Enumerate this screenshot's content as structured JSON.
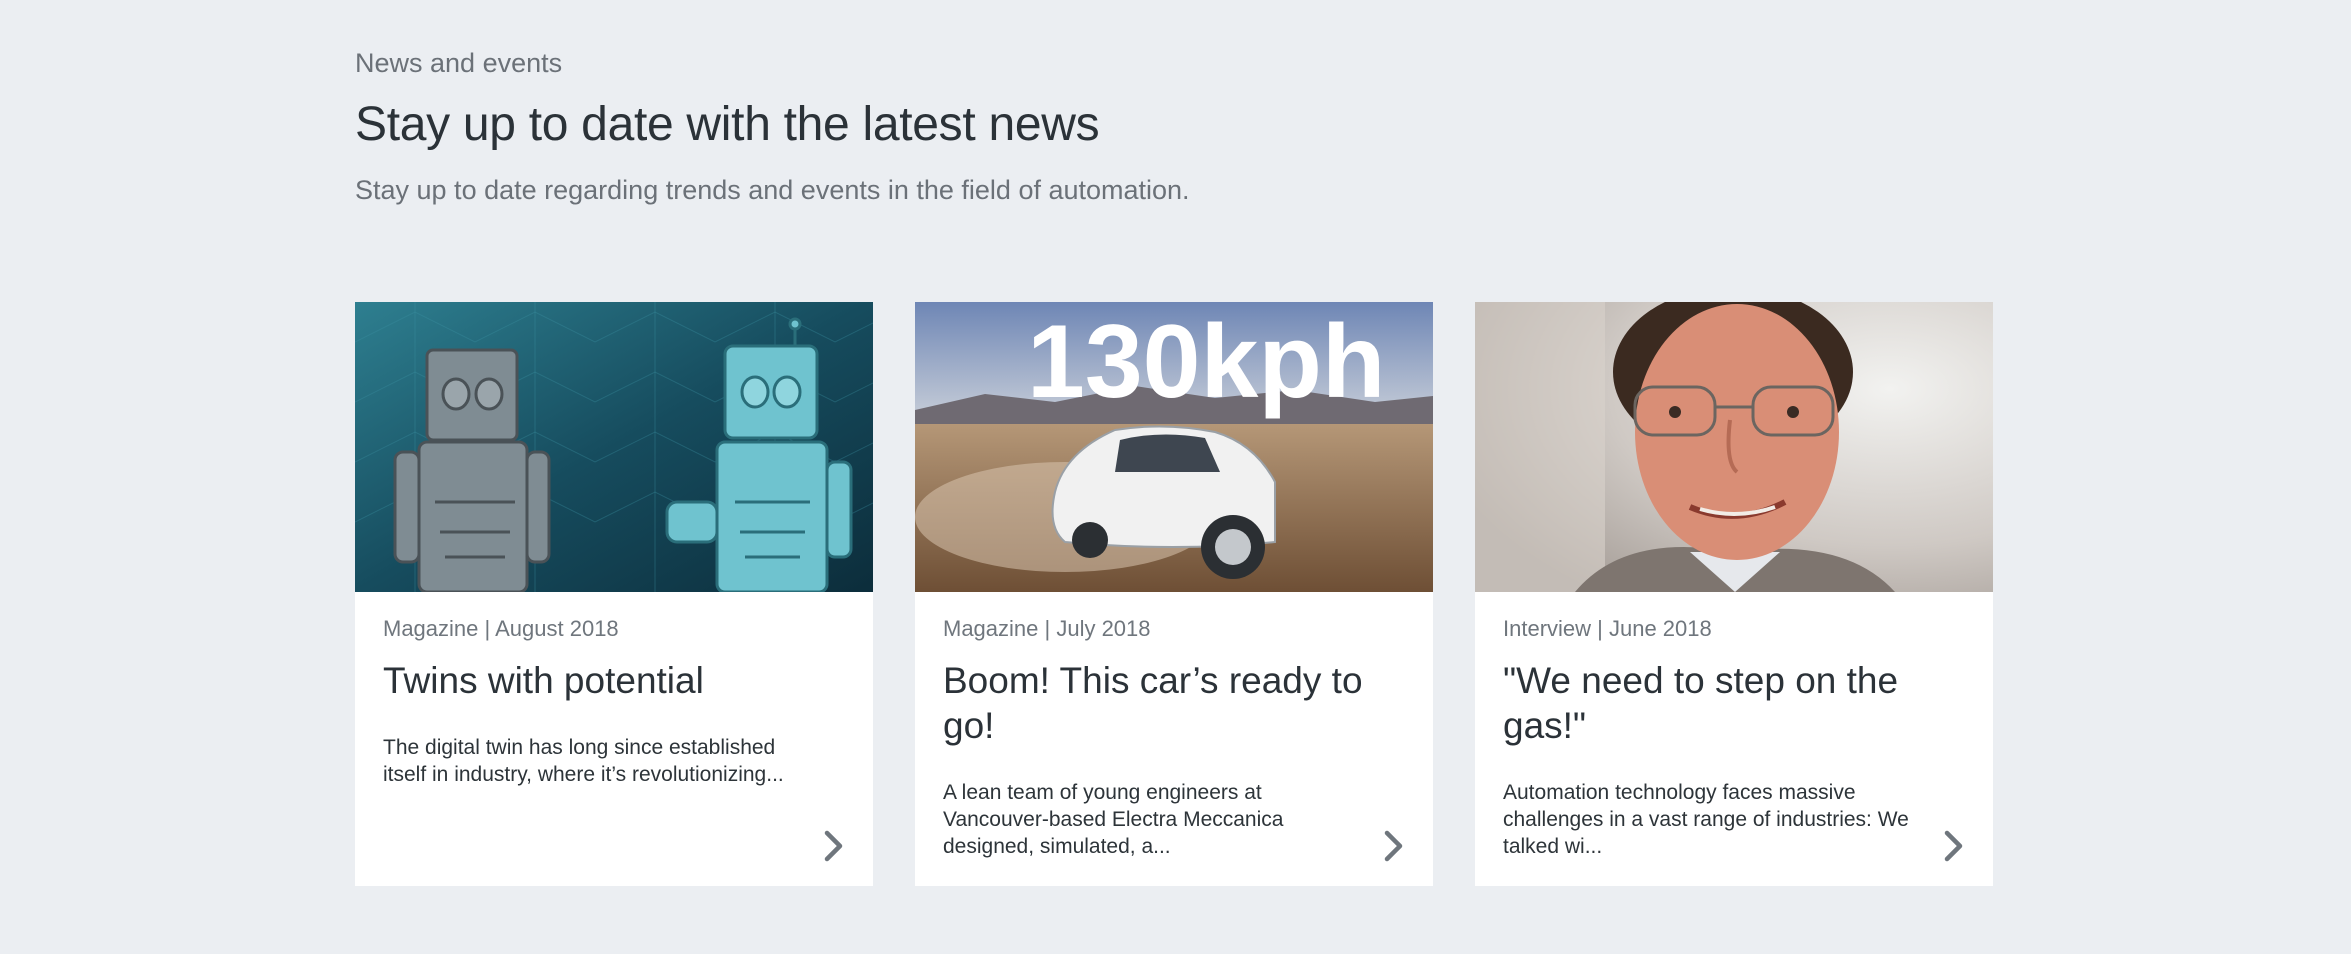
{
  "section": {
    "eyebrow": "News and events",
    "heading": "Stay up to date with the latest news",
    "subheading": "Stay up to date regarding trends and events in the field of automation."
  },
  "cards": [
    {
      "meta": "Magazine | August 2018",
      "title": "Twins with potential",
      "teaser": "The digital twin has long since established itself in industry, where it’s revolutionizing...",
      "image": "robots-digital-twin-illustration",
      "arrow_icon": "chevron-right-icon"
    },
    {
      "meta": "Magazine | July 2018",
      "title": "Boom! This car’s ready to go!",
      "teaser": "A lean team of young engineers at Vancouver-based Electra Meccanica designed, simulated, a...",
      "image": "white-electric-car-desert",
      "image_text": "130kph",
      "arrow_icon": "chevron-right-icon"
    },
    {
      "meta": "Interview | June 2018",
      "title": "\"We need to step on the gas!\"",
      "teaser": "Automation technology faces massive challenges in a vast range of industries: We talked wi...",
      "image": "man-with-glasses-portrait",
      "arrow_icon": "chevron-right-icon"
    }
  ],
  "colors": {
    "page_background": "#ebeef2",
    "card_background": "#ffffff",
    "text_dark": "#2b3238",
    "text_muted": "#6b7178",
    "arrow": "#6f767d"
  }
}
